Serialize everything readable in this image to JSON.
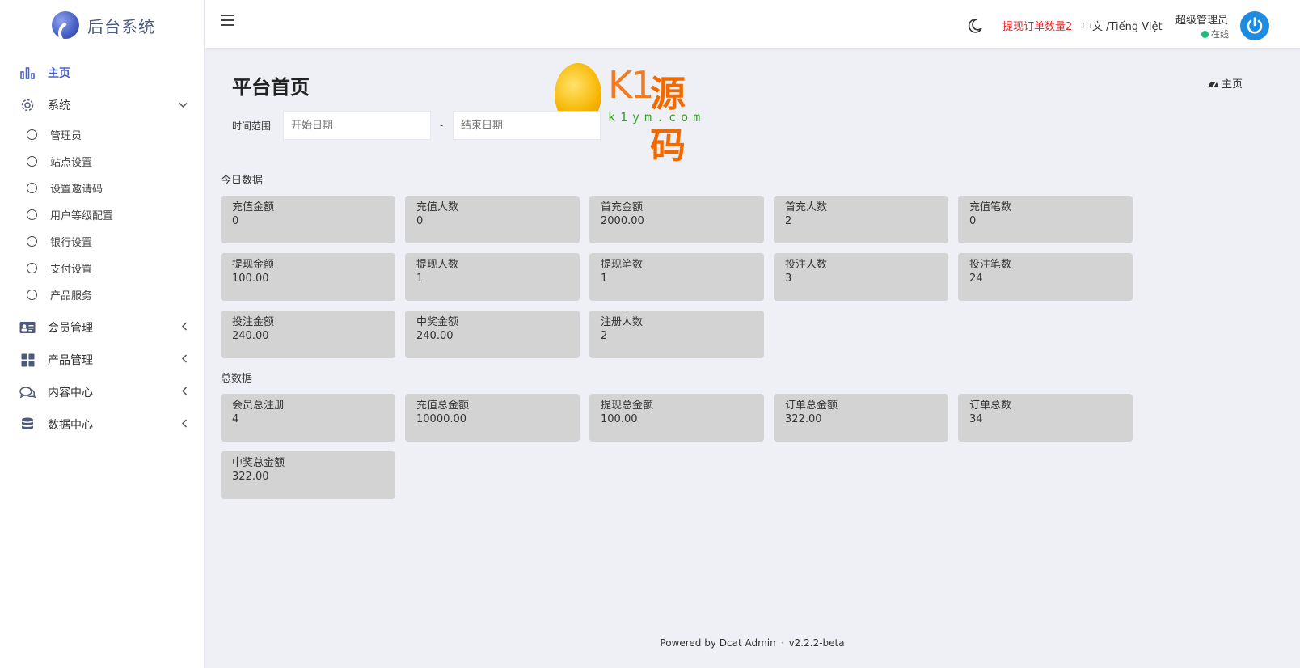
{
  "brand": {
    "name": "后台系统"
  },
  "sidebar": {
    "items": [
      {
        "label": "主页"
      },
      {
        "label": "系统"
      },
      {
        "label": "会员管理"
      },
      {
        "label": "产品管理"
      },
      {
        "label": "内容中心"
      },
      {
        "label": "数据中心"
      }
    ],
    "system_children": [
      {
        "label": "管理员"
      },
      {
        "label": "站点设置"
      },
      {
        "label": "设置邀请码"
      },
      {
        "label": "用户等级配置"
      },
      {
        "label": "银行设置"
      },
      {
        "label": "支付设置"
      },
      {
        "label": "产品服务"
      }
    ]
  },
  "topbar": {
    "withdraw_alert": "提现订单数量2",
    "language": "中文 /Tiếng Việt",
    "user_name": "超级管理员",
    "user_status": "在线"
  },
  "page": {
    "title": "平台首页",
    "breadcrumb": "主页",
    "filter_label": "时间范围",
    "start_placeholder": "开始日期",
    "end_placeholder": "结束日期",
    "date_separator": "-"
  },
  "today": {
    "title": "今日数据",
    "cards": [
      {
        "label": "充值金额",
        "value": "0"
      },
      {
        "label": "充值人数",
        "value": "0"
      },
      {
        "label": "首充金额",
        "value": "2000.00"
      },
      {
        "label": "首充人数",
        "value": "2"
      },
      {
        "label": "充值笔数",
        "value": "0"
      },
      {
        "label": "提现金额",
        "value": "100.00"
      },
      {
        "label": "提现人数",
        "value": "1"
      },
      {
        "label": "提现笔数",
        "value": "1"
      },
      {
        "label": "投注人数",
        "value": "3"
      },
      {
        "label": "投注笔数",
        "value": "24"
      },
      {
        "label": "投注金额",
        "value": "240.00"
      },
      {
        "label": "中奖金额",
        "value": "240.00"
      },
      {
        "label": "注册人数",
        "value": "2"
      }
    ]
  },
  "total": {
    "title": "总数据",
    "cards": [
      {
        "label": "会员总注册",
        "value": "4"
      },
      {
        "label": "充值总金额",
        "value": "10000.00"
      },
      {
        "label": "提现总金额",
        "value": "100.00"
      },
      {
        "label": "订单总金额",
        "value": "322.00"
      },
      {
        "label": "订单总数",
        "value": "34"
      },
      {
        "label": "中奖总金额",
        "value": "322.00"
      }
    ]
  },
  "footer": {
    "powered": "Powered by Dcat Admin",
    "dot": "·",
    "version": "v2.2.2-beta"
  },
  "watermark": {
    "brand": "K1",
    "brand_cn": "源码",
    "url": "k1ym.com"
  },
  "colors": {
    "accent": "#4a62c8",
    "alert": "#e02424",
    "card_bg": "#d3d3d3",
    "online": "#21b978"
  },
  "icons": [
    "bar-chart-icon",
    "gear-icon",
    "chevron-down-icon",
    "circle-icon",
    "id-card-icon",
    "grid-icon",
    "chat-icon",
    "database-icon",
    "chevron-left-icon",
    "menu-icon",
    "moon-icon",
    "power-icon",
    "dashboard-icon"
  ]
}
